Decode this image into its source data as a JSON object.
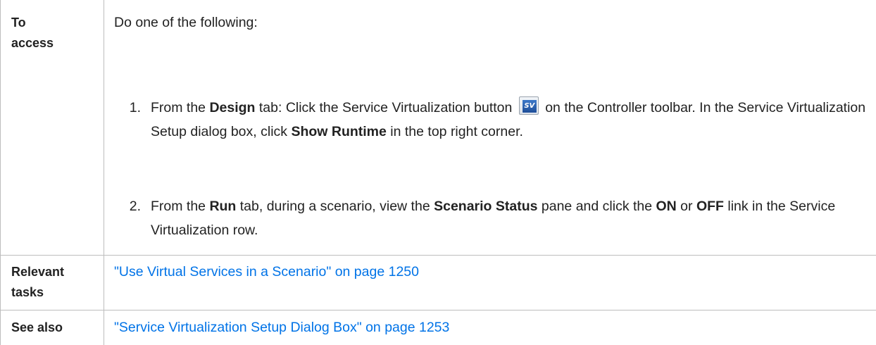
{
  "rows": {
    "access": {
      "label_line1": "To",
      "label_line2": "access",
      "intro": "Do one of the following:",
      "items": [
        {
          "number": "1.",
          "seg1": "From the ",
          "bold1": "Design",
          "seg2": " tab: Click the Service Virtualization button ",
          "icon": "sv-icon",
          "seg3": " on the Controller toolbar. In the Service Virtualization Setup dialog box, click ",
          "bold2": "Show Runtime",
          "seg4": " in the top right corner."
        },
        {
          "number": "2.",
          "seg1": "From the ",
          "bold1": "Run",
          "seg2": " tab, during a scenario, view the ",
          "bold2": "Scenario Status",
          "seg3": " pane and click the ",
          "bold3": "ON",
          "seg4": " or ",
          "bold4": "OFF",
          "seg5": " link in the Service Virtualization row."
        }
      ]
    },
    "relevant_tasks": {
      "label_line1": "Relevant",
      "label_line2": "tasks",
      "link": "\"Use Virtual Services in a Scenario\" on page 1250"
    },
    "see_also": {
      "label": "See also",
      "link": "\"Service Virtualization Setup Dialog Box\" on page 1253"
    }
  },
  "icon_text": "SV",
  "colors": {
    "link": "#0073e7",
    "border": "#bdbdbd",
    "text": "#222222"
  }
}
